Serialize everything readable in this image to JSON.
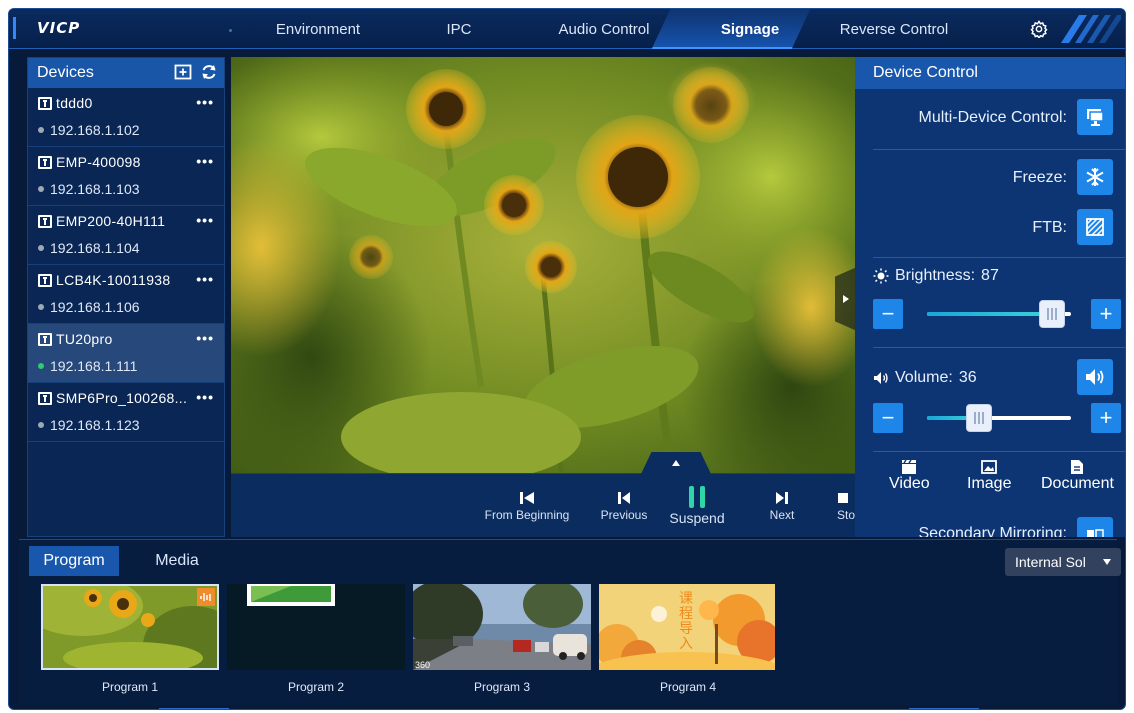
{
  "app": {
    "brand": "VICP"
  },
  "nav": {
    "items": [
      "Environment",
      "IPC",
      "Audio Control",
      "Signage",
      "Reverse Control"
    ],
    "active": "Signage"
  },
  "devices": {
    "title": "Devices",
    "items": [
      {
        "name": "tddd0",
        "ip": "192.168.1.102",
        "online": false,
        "more": "•••"
      },
      {
        "name": "EMP-400098",
        "ip": "192.168.1.103",
        "online": false,
        "more": "•••"
      },
      {
        "name": "EMP200-40H111",
        "ip": "192.168.1.104",
        "online": false,
        "more": "•••"
      },
      {
        "name": "LCB4K-10011938",
        "ip": "192.168.1.106",
        "online": false,
        "more": "•••"
      },
      {
        "name": "TU20pro",
        "ip": "192.168.1.111",
        "online": true,
        "more": "•••"
      },
      {
        "name": "SMP6Pro_100268...",
        "ip": "192.168.1.123",
        "online": false,
        "more": "•••"
      }
    ],
    "selected_index": 4
  },
  "playback": {
    "from_beginning": "From Beginning",
    "previous": "Previous",
    "suspend": "Suspend",
    "next": "Next",
    "stop": "Sto"
  },
  "device_control": {
    "title": "Device Control",
    "multi_device": "Multi-Device Control:",
    "freeze": "Freeze:",
    "ftb": "FTB:",
    "brightness_label": "Brightness:",
    "brightness_value": "87",
    "brightness_level": 0.87,
    "volume_label": "Volume:",
    "volume_value": "36",
    "volume_level": 0.36,
    "media_types": [
      "Video",
      "Image",
      "Document"
    ],
    "secondary_mirroring": "Secondary Mirroring:"
  },
  "bottom": {
    "tabs": [
      "Program",
      "Media"
    ],
    "active_tab": "Program",
    "source": "Internal Sol",
    "programs": [
      "Program 1",
      "Program 2",
      "Program 3",
      "Program 4"
    ],
    "thumb4_text": "课程导入",
    "thumb3_text": "360"
  },
  "colors": {
    "accent": "#1d86e8",
    "panel_head": "#1957ad",
    "bg": "#071a3a",
    "online": "#2ecc71"
  }
}
